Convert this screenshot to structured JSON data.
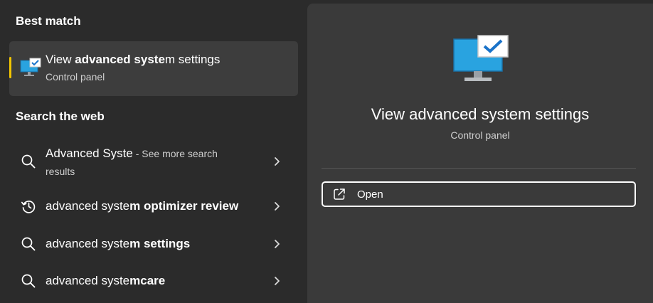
{
  "best_match": {
    "heading": "Best match",
    "title_pre": "View ",
    "title_bold": "advanced syste",
    "title_post": "m settings",
    "subtitle": "Control panel"
  },
  "web": {
    "heading": "Search the web",
    "items": [
      {
        "pre": "Advanced Syste",
        "bold": "",
        "hint": " - See more search",
        "sub": "results",
        "icon": "search-icon"
      },
      {
        "pre": "advanced syste",
        "bold": "m optimizer review",
        "hint": "",
        "sub": "",
        "icon": "history-icon"
      },
      {
        "pre": "advanced syste",
        "bold": "m settings",
        "hint": "",
        "sub": "",
        "icon": "search-icon"
      },
      {
        "pre": "advanced syste",
        "bold": "mcare",
        "hint": "",
        "sub": "",
        "icon": "search-icon"
      }
    ]
  },
  "detail": {
    "title": "View advanced system settings",
    "subtitle": "Control panel",
    "open_label": "Open"
  },
  "colors": {
    "background": "#2b2b2b",
    "panel": "#3a3a3a",
    "selected": "#3d3d3d",
    "accent": "#f3c600",
    "monitor": "#29a3e0"
  }
}
